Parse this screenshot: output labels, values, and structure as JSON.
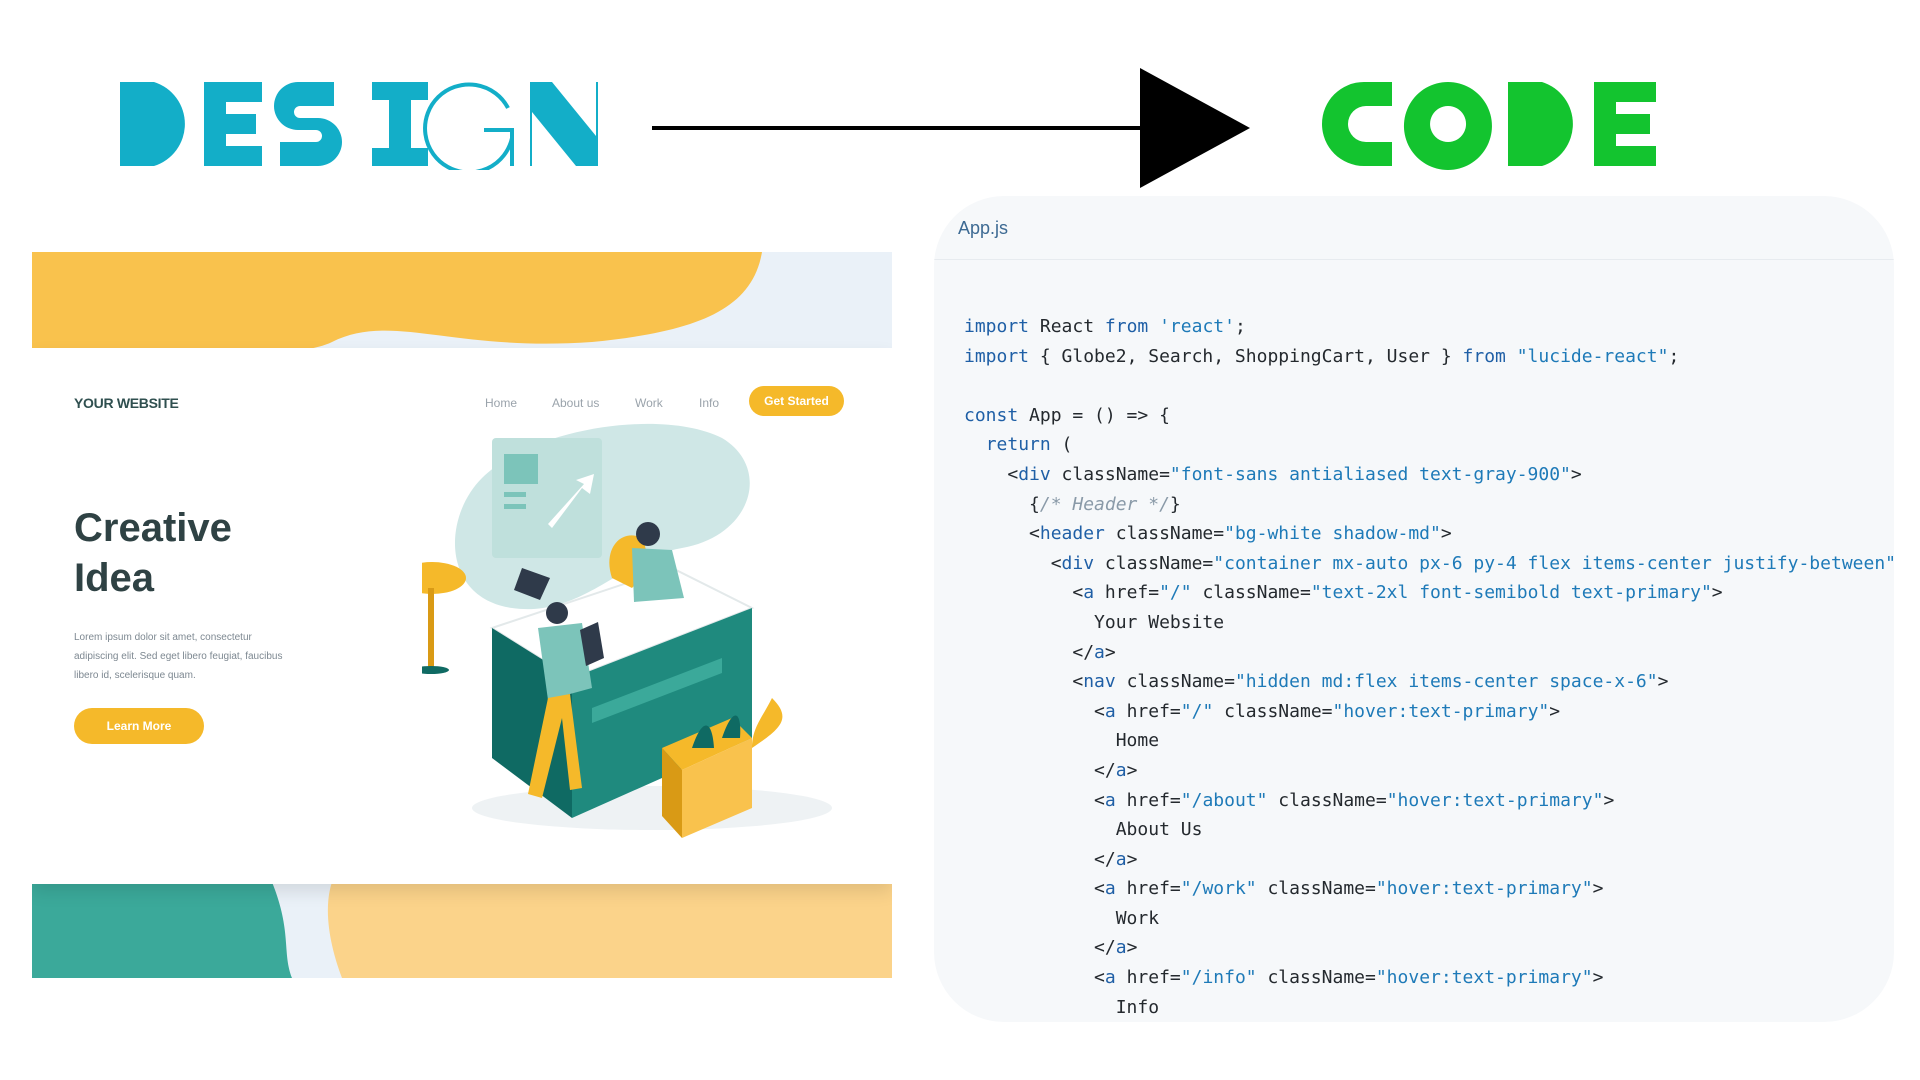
{
  "colors": {
    "design": "#13aec8",
    "code": "#13c42f",
    "arrow": "#000000",
    "panel_bg": "#f6f8fa",
    "accent_yellow": "#f5b92a",
    "teal": "#1f8a7e"
  },
  "headers": {
    "design": "DESIGN",
    "code": "CODE"
  },
  "mockup": {
    "logo": "YOUR WEBSITE",
    "nav": [
      "Home",
      "About us",
      "Work",
      "Info"
    ],
    "cta": "Get Started",
    "headline_line1": "Creative",
    "headline_line2": "Idea",
    "body_lines": [
      "Lorem ipsum dolor sit amet, consectetur",
      "adipiscing elit. Sed eget libero feugiat, faucibus",
      "libero id, scelerisque quam."
    ],
    "button": "Learn More"
  },
  "editor": {
    "filename": "App.js",
    "lines": [
      [
        {
          "c": "k",
          "v": "import"
        },
        {
          "v": " React "
        },
        {
          "c": "k",
          "v": "from"
        },
        {
          "v": " "
        },
        {
          "c": "s",
          "v": "'react'"
        },
        {
          "v": ";"
        }
      ],
      [
        {
          "c": "k",
          "v": "import"
        },
        {
          "v": " { Globe2, Search, ShoppingCart, User } "
        },
        {
          "c": "k",
          "v": "from"
        },
        {
          "v": " "
        },
        {
          "c": "s",
          "v": "\"lucide-react\""
        },
        {
          "v": ";"
        }
      ],
      [],
      [
        {
          "c": "k",
          "v": "const"
        },
        {
          "v": " App = () => {"
        }
      ],
      [
        {
          "v": "  "
        },
        {
          "c": "k",
          "v": "return"
        },
        {
          "v": " ("
        }
      ],
      [
        {
          "v": "    <"
        },
        {
          "c": "t",
          "v": "div"
        },
        {
          "v": " className="
        },
        {
          "c": "s",
          "v": "\"font-sans antialiased text-gray-900\""
        },
        {
          "v": ">"
        }
      ],
      [
        {
          "v": "      {"
        },
        {
          "c": "c",
          "v": "/* Header */"
        },
        {
          "v": "}"
        }
      ],
      [
        {
          "v": "      <"
        },
        {
          "c": "t",
          "v": "header"
        },
        {
          "v": " className="
        },
        {
          "c": "s",
          "v": "\"bg-white shadow-md\""
        },
        {
          "v": ">"
        }
      ],
      [
        {
          "v": "        <"
        },
        {
          "c": "t",
          "v": "div"
        },
        {
          "v": " className="
        },
        {
          "c": "s",
          "v": "\"container mx-auto px-6 py-4 flex items-center justify-between\""
        },
        {
          "v": ">"
        }
      ],
      [
        {
          "v": "          <"
        },
        {
          "c": "t",
          "v": "a"
        },
        {
          "v": " href="
        },
        {
          "c": "s",
          "v": "\"/\""
        },
        {
          "v": " className="
        },
        {
          "c": "s",
          "v": "\"text-2xl font-semibold text-primary\""
        },
        {
          "v": ">"
        }
      ],
      [
        {
          "v": "            Your Website"
        }
      ],
      [
        {
          "v": "          </"
        },
        {
          "c": "t",
          "v": "a"
        },
        {
          "v": ">"
        }
      ],
      [
        {
          "v": "          <"
        },
        {
          "c": "t",
          "v": "nav"
        },
        {
          "v": " className="
        },
        {
          "c": "s",
          "v": "\"hidden md:flex items-center space-x-6\""
        },
        {
          "v": ">"
        }
      ],
      [
        {
          "v": "            <"
        },
        {
          "c": "t",
          "v": "a"
        },
        {
          "v": " href="
        },
        {
          "c": "s",
          "v": "\"/\""
        },
        {
          "v": " className="
        },
        {
          "c": "s",
          "v": "\"hover:text-primary\""
        },
        {
          "v": ">"
        }
      ],
      [
        {
          "v": "              Home"
        }
      ],
      [
        {
          "v": "            </"
        },
        {
          "c": "t",
          "v": "a"
        },
        {
          "v": ">"
        }
      ],
      [
        {
          "v": "            <"
        },
        {
          "c": "t",
          "v": "a"
        },
        {
          "v": " href="
        },
        {
          "c": "s",
          "v": "\"/about\""
        },
        {
          "v": " className="
        },
        {
          "c": "s",
          "v": "\"hover:text-primary\""
        },
        {
          "v": ">"
        }
      ],
      [
        {
          "v": "              About Us"
        }
      ],
      [
        {
          "v": "            </"
        },
        {
          "c": "t",
          "v": "a"
        },
        {
          "v": ">"
        }
      ],
      [
        {
          "v": "            <"
        },
        {
          "c": "t",
          "v": "a"
        },
        {
          "v": " href="
        },
        {
          "c": "s",
          "v": "\"/work\""
        },
        {
          "v": " className="
        },
        {
          "c": "s",
          "v": "\"hover:text-primary\""
        },
        {
          "v": ">"
        }
      ],
      [
        {
          "v": "              Work"
        }
      ],
      [
        {
          "v": "            </"
        },
        {
          "c": "t",
          "v": "a"
        },
        {
          "v": ">"
        }
      ],
      [
        {
          "v": "            <"
        },
        {
          "c": "t",
          "v": "a"
        },
        {
          "v": " href="
        },
        {
          "c": "s",
          "v": "\"/info\""
        },
        {
          "v": " className="
        },
        {
          "c": "s",
          "v": "\"hover:text-primary\""
        },
        {
          "v": ">"
        }
      ],
      [
        {
          "v": "              Info"
        }
      ]
    ]
  }
}
